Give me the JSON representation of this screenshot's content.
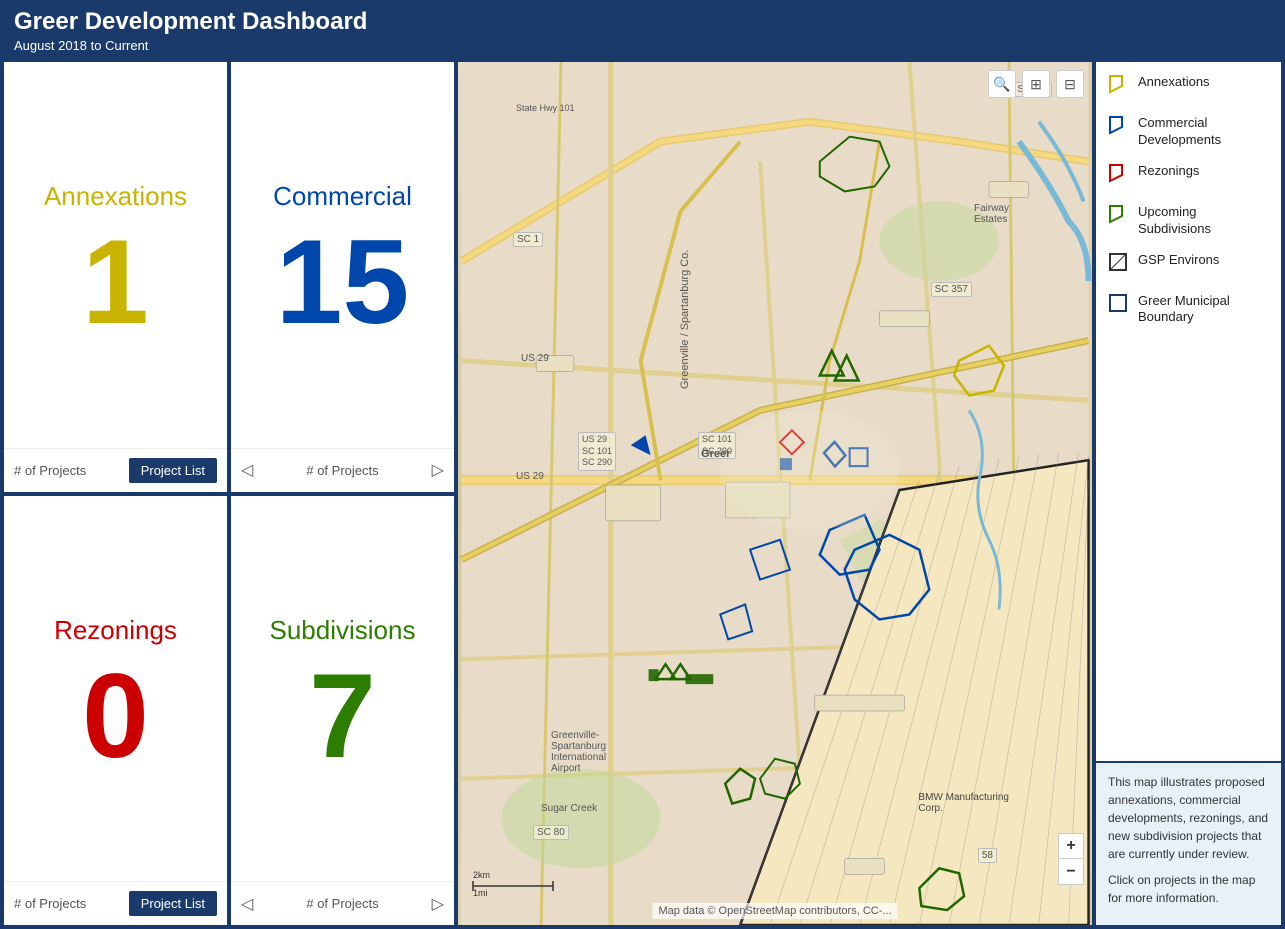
{
  "header": {
    "title": "Greer Development Dashboard",
    "subtitle": "August 2018 to Current"
  },
  "cards": [
    {
      "id": "annexations",
      "title": "Annexations",
      "number": "1",
      "color": "yellow",
      "footer_type": "btn",
      "footer_label": "# of Projects",
      "btn_label": "Project List"
    },
    {
      "id": "commercial",
      "title": "Commercial",
      "number": "15",
      "color": "blue",
      "footer_type": "nav",
      "footer_label": "# of Projects"
    },
    {
      "id": "rezonings",
      "title": "Rezonings",
      "number": "0",
      "color": "red",
      "footer_type": "btn",
      "footer_label": "# of Projects",
      "btn_label": "Project List"
    },
    {
      "id": "subdivisions",
      "title": "Subdivisions",
      "number": "7",
      "color": "green",
      "footer_type": "nav",
      "footer_label": "# of Projects"
    }
  ],
  "legend": {
    "items": [
      {
        "label": "Annexations",
        "color": "yellow",
        "shape": "flag"
      },
      {
        "label": "Commercial Developments",
        "color": "blue",
        "shape": "flag"
      },
      {
        "label": "Rezonings",
        "color": "red",
        "shape": "flag"
      },
      {
        "label": "Upcoming Subdivisions",
        "color": "green",
        "shape": "flag"
      },
      {
        "label": "GSP Environs",
        "color": "black",
        "shape": "boundary"
      },
      {
        "label": "Greer Municipal Boundary",
        "color": "darkblue",
        "shape": "boundary"
      }
    ]
  },
  "info_box": {
    "text1": "This map illustrates proposed annexations, commercial developments, rezonings, and new subdivision projects that are currently under review.",
    "text2": "Click on projects in the map for more information."
  },
  "map": {
    "attribution": "Map data © OpenStreetMap contributors, CC-...",
    "zoom_in_label": "+",
    "zoom_out_label": "−"
  }
}
